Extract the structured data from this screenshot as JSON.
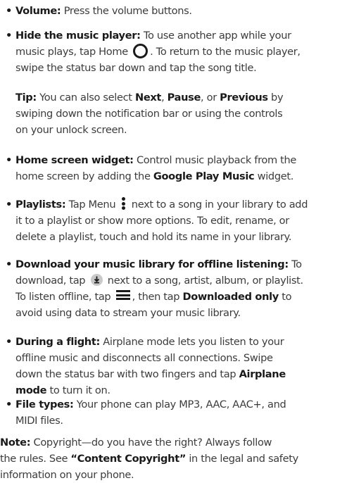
{
  "bullet": "•",
  "volume": {
    "label": "Volume:",
    "text": " Press the volume buttons."
  },
  "hide": {
    "label": "Hide the music player:",
    "l1": " To use another app while your",
    "l2a": "music plays, tap Home ",
    "l2b": ". To return to the music player,",
    "l3": "swipe the status bar down and tap the song title."
  },
  "tip": {
    "label": "Tip:",
    "l1a": " You can also select ",
    "next": "Next",
    "sep1": ", ",
    "pause": "Pause",
    "sep2": ", or ",
    "previous": "Previous",
    "l1b": " by",
    "l2": "swiping down the notification bar or using the controls",
    "l3": "on your unlock screen."
  },
  "widget": {
    "label": "Home screen widget:",
    "l1": " Control music playback from the",
    "l2a": "home screen by adding the ",
    "app": "Google Play Music",
    "l2b": " widget."
  },
  "playlists": {
    "label": "Playlists:",
    "l1a": " Tap Menu ",
    "l1b": " next to a song in your library to add",
    "l2": "it to a playlist or show more options. To edit, rename, or",
    "l3": "delete a playlist, touch and hold its name in your library."
  },
  "download": {
    "label": "Download your music library for offline listening:",
    "l1": " To",
    "l2a": "download, tap ",
    "l2b": " next to a song, artist, album, or playlist.",
    "l3a": "To listen offline, tap ",
    "l3b": ", then tap ",
    "option": "Downloaded only",
    "l3c": " to",
    "l4": "avoid using data to stream your music library."
  },
  "flight": {
    "label": "During a flight:",
    "l1": " Airplane mode lets you listen to your",
    "l2": "offline music and disconnects all connections. Swipe",
    "l3a": "down the status bar with two fingers and tap ",
    "airplane": "Airplane",
    "mode": "mode",
    "l4b": " to turn it on."
  },
  "filetypes": {
    "label": "File types:",
    "l1": " Your phone can play MP3, AAC, AAC+, and",
    "l2": "MIDI files."
  },
  "note": {
    "label": "Note:",
    "l1": " Copyright—do you have the right? Always follow",
    "l2a": "the rules. See ",
    "copyright": "“Content Copyright”",
    "l2b": " in the legal and safety",
    "l3": "information on your phone."
  }
}
